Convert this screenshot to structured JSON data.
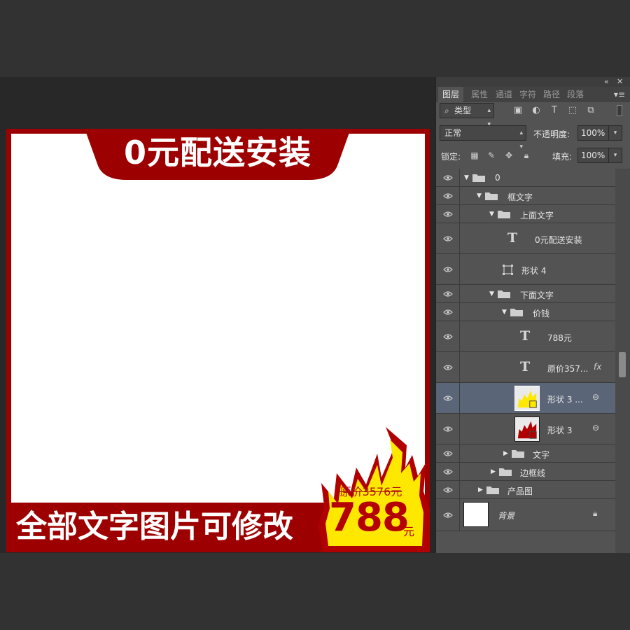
{
  "canvas": {
    "top_banner": "0元配送安装",
    "bottom_banner": "全部文字图片可修改",
    "original_price": "原价3576元",
    "price": "788",
    "price_unit": "元",
    "colors": {
      "red": "#9d0000",
      "flame_yellow": "#ffe800",
      "price_red": "#b50000"
    }
  },
  "panel": {
    "tabs": [
      "图层",
      "属性",
      "通道",
      "字符",
      "路径",
      "段落"
    ],
    "filter_kind": "类型",
    "filter_icons": [
      "image-filter-icon",
      "adjustment-filter-icon",
      "type-filter-icon",
      "shape-filter-icon",
      "smart-object-filter-icon"
    ],
    "blend_mode": "正常",
    "opacity_label": "不透明度:",
    "opacity_value": "100%",
    "lock_label": "锁定:",
    "fill_label": "填充:",
    "fill_value": "100%",
    "layers": [
      {
        "name": "0",
        "type": "group",
        "expanded": true
      },
      {
        "name": "框文字",
        "type": "group",
        "expanded": true
      },
      {
        "name": "上面文字",
        "type": "group",
        "expanded": true
      },
      {
        "name": "0元配送安装",
        "type": "text"
      },
      {
        "name": "形状 4",
        "type": "shape"
      },
      {
        "name": "下面文字",
        "type": "group",
        "expanded": true
      },
      {
        "name": "价钱",
        "type": "group",
        "expanded": true
      },
      {
        "name": "788元",
        "type": "text"
      },
      {
        "name": "原价357...",
        "type": "text",
        "fx": "fx"
      },
      {
        "name": "形状 3 ...",
        "type": "shape",
        "selected": true
      },
      {
        "name": "形状 3",
        "type": "shape"
      },
      {
        "name": "文字",
        "type": "group",
        "expanded": false
      },
      {
        "name": "边框线",
        "type": "group",
        "expanded": false
      },
      {
        "name": "产品图",
        "type": "group",
        "expanded": false
      },
      {
        "name": "背景",
        "type": "background",
        "locked": true
      }
    ]
  }
}
